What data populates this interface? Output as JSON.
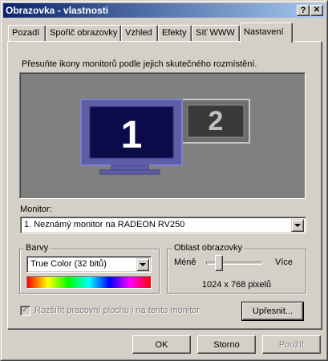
{
  "window": {
    "title": "Obrazovka - vlastnosti",
    "help_button": "?",
    "close_button": "✕"
  },
  "tabs": [
    {
      "label": "Pozadí"
    },
    {
      "label": "Spořič obrazovky"
    },
    {
      "label": "Vzhled"
    },
    {
      "label": "Efekty"
    },
    {
      "label": "Síť WWW"
    },
    {
      "label": "Nastavení",
      "active": true
    }
  ],
  "settings": {
    "instruction": "Přesuňte ikony monitorů podle jejich skutečného rozmístění.",
    "monitors": [
      {
        "number": "1",
        "selected": true
      },
      {
        "number": "2",
        "selected": false
      }
    ],
    "monitor_label": "Monitor:",
    "monitor_value": "1. Neznámý monitor na RADEON RV250",
    "colors_group": "Barvy",
    "colors_value": "True Color (32 bitů)",
    "screen_area_group": "Oblast obrazovky",
    "slider_less": "Méně",
    "slider_more": "Více",
    "resolution": "1024 x 768 pixelů",
    "extend_checkbox": "Rozšířit pracovní plochu i na tento monitor",
    "extend_checked": true,
    "advanced_button": "Upřesnit..."
  },
  "buttons": {
    "ok": "OK",
    "cancel": "Storno",
    "apply": "Použít"
  },
  "colors": {
    "titlebar": "#0a246a",
    "face": "#d4d0c8",
    "monitor_frame": "#5d5da8",
    "monitor_screen": "#0b0b4a"
  }
}
